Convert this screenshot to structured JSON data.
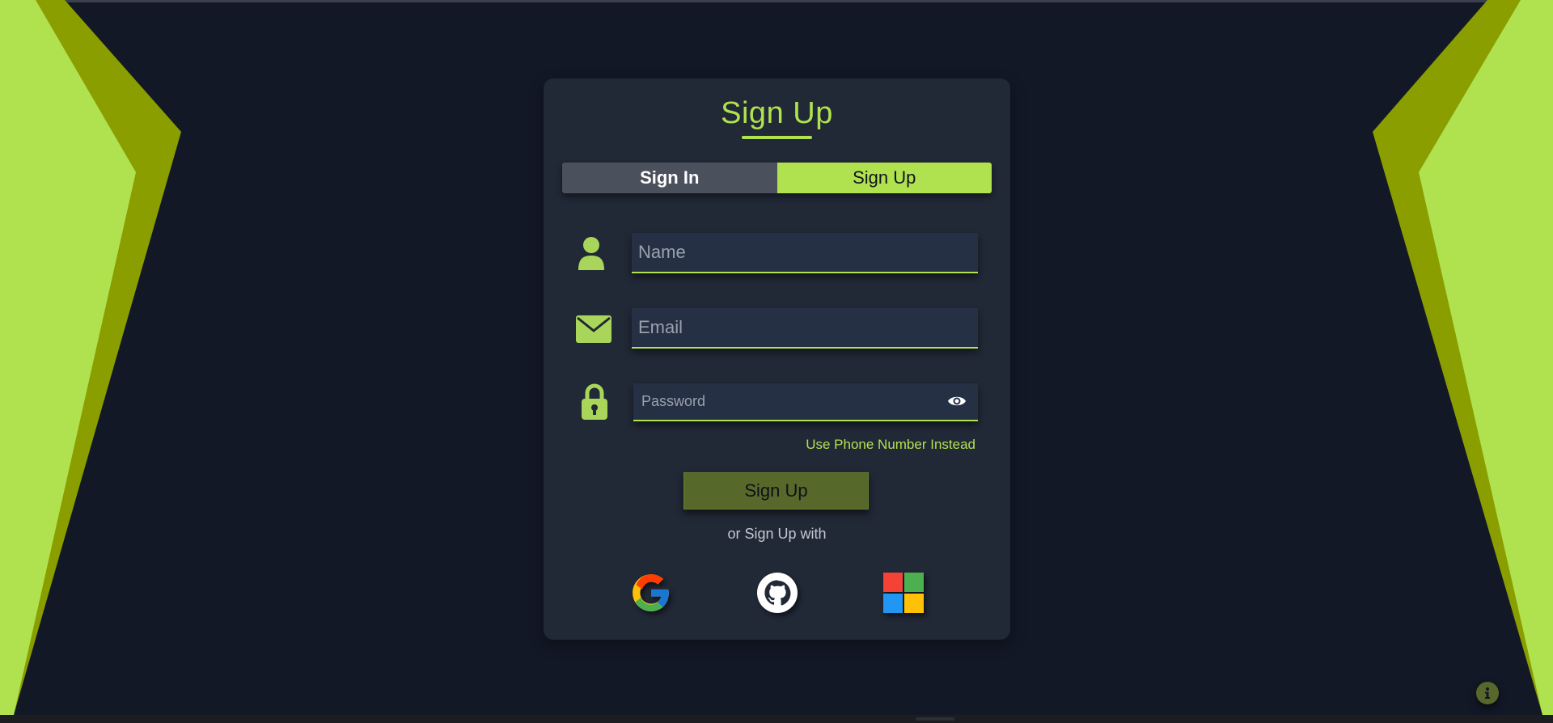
{
  "colors": {
    "background": "#121826",
    "card": "#212836",
    "accent": "#b0e24f",
    "accent_dark": "#8a9e00",
    "button": "#56692a"
  },
  "form": {
    "title": "Sign Up",
    "tabs": [
      {
        "label": "Sign In",
        "active": false
      },
      {
        "label": "Sign Up",
        "active": true
      }
    ],
    "name": {
      "icon": "user-icon",
      "placeholder": "Name",
      "value": ""
    },
    "email": {
      "icon": "envelope-icon",
      "placeholder": "Email",
      "value": ""
    },
    "password": {
      "icon": "lock-icon",
      "placeholder": "Password",
      "value": "",
      "toggle_icon": "eye-icon"
    },
    "phone_link": "Use Phone Number Instead",
    "submit_label": "Sign Up",
    "alt_text": "or Sign Up with",
    "social": [
      {
        "name": "google",
        "icon": "google-icon"
      },
      {
        "name": "github",
        "icon": "github-icon"
      },
      {
        "name": "microsoft",
        "icon": "microsoft-icon"
      }
    ]
  },
  "info_button": {
    "icon": "info-icon"
  }
}
